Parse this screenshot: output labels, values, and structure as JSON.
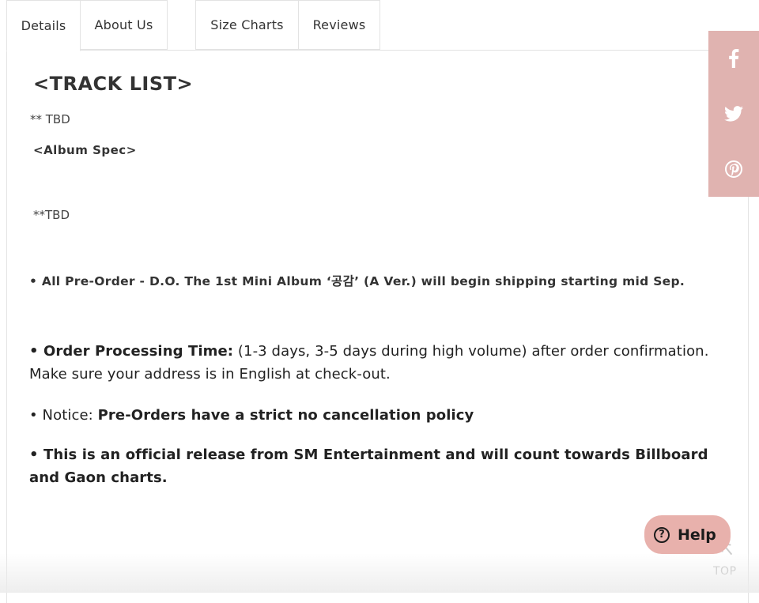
{
  "tabs": {
    "details": "Details",
    "about": "About Us",
    "size_charts": "Size Charts",
    "reviews": "Reviews"
  },
  "content": {
    "track_list_title": "<TRACK LIST>",
    "track_list_tbd": "** TBD",
    "album_spec_title": "<Album Spec>",
    "album_spec_tbd": "**TBD",
    "preorder_notice": "• All Pre-Order - D.O. The 1st Mini Album ‘공감’ (A Ver.) will begin shipping starting mid Sep.",
    "processing_label": "• Order Processing Time:",
    "processing_text": " (1-3 days, 3-5 days during high volume) after order confirmation. Make sure your address is in English at check-out.",
    "notice_label": "• Notice: ",
    "notice_text": "Pre-Orders have a strict no cancellation policy",
    "official_release": "• This is an official release from SM Entertainment and will count towards Billboard and Gaon charts."
  },
  "share": {
    "bg_color": "#e0b3b0",
    "icons": [
      "facebook-icon",
      "twitter-icon",
      "pinterest-icon"
    ]
  },
  "help": {
    "label": "Help",
    "icon": "question-icon",
    "bg_color": "#e8b1ac"
  },
  "back_to_top": {
    "label": "TOP",
    "icon": "arrow-up-icon"
  }
}
